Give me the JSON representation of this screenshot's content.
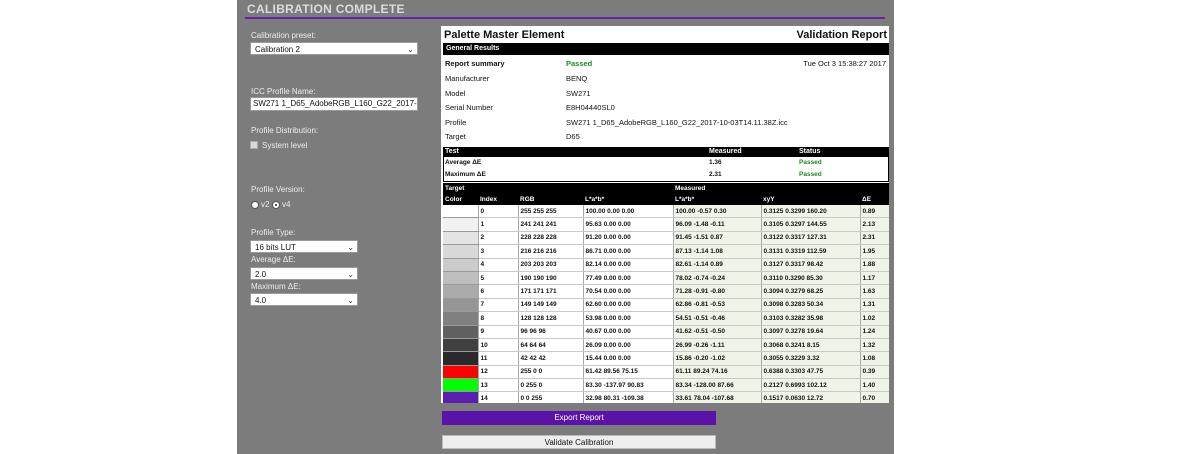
{
  "window": {
    "title": "CALIBRATION COMPLETE"
  },
  "colors": {
    "accent": "#6a1fa6",
    "passed": "#1c8a1c",
    "panel_bg": "#7c7c7c"
  },
  "sidebar": {
    "preset_label": "Calibration preset:",
    "preset_value": "Calibration 2",
    "icc_label": "ICC Profile Name:",
    "icc_value": "SW271 1_D65_AdobeRGB_L160_G22_2017-",
    "distribution_label": "Profile Distribution:",
    "system_level": "System level",
    "version_label": "Profile Version:",
    "version_v2": "v2",
    "version_v4": "v4",
    "version_selected": "v4",
    "type_label": "Profile Type:",
    "type_value": "16 bits LUT",
    "avg_label": "Average ΔE:",
    "avg_value": "2.0",
    "max_label": "Maximum ΔE:",
    "max_value": "4.0"
  },
  "report": {
    "app_name": "Palette Master Element",
    "report_title": "Validation Report",
    "general_results": "General Results",
    "summary_label": "Report summary",
    "summary_status": "Passed",
    "date": "Tue Oct 3 15:38:27 2017",
    "info": [
      {
        "label": "Manufacturer",
        "value": "BENQ"
      },
      {
        "label": "Model",
        "value": "SW271"
      },
      {
        "label": "Serial Number",
        "value": "E8H04440SL0"
      },
      {
        "label": "Profile",
        "value": "SW271 1_D65_AdobeRGB_L160_G22_2017-10-03T14.11.38Z.icc"
      },
      {
        "label": "Target",
        "value": "D65"
      }
    ],
    "test_headers": {
      "test": "Test",
      "measured": "Measured",
      "status": "Status"
    },
    "tests": [
      {
        "name": "Average ΔE",
        "measured": "1.36",
        "status": "Passed"
      },
      {
        "name": "Maximum ΔE",
        "measured": "2.31",
        "status": "Passed"
      }
    ],
    "group_headers": {
      "target": "Target",
      "measured": "Measured"
    },
    "col_headers": {
      "color": "Color",
      "index": "Index",
      "rgb": "RGB",
      "lab_target": "L*a*b*",
      "lab_measured": "L*a*b*",
      "xyy": "xyY",
      "de": "ΔE"
    },
    "rows": [
      {
        "swatch": "#ffffff",
        "index": "0",
        "rgb": "255  255  255",
        "lab_t": "100.00  0.00  0.00",
        "lab_m": "100.00  -0.57  0.30",
        "xyy": "0.3125  0.3299  160.20",
        "de": "0.89"
      },
      {
        "swatch": "#f1f1f1",
        "index": "1",
        "rgb": "241  241  241",
        "lab_t": "95.63  0.00  0.00",
        "lab_m": "96.09  -1.48  -0.11",
        "xyy": "0.3105  0.3297  144.55",
        "de": "2.13"
      },
      {
        "swatch": "#e4e4e4",
        "index": "2",
        "rgb": "228  228  228",
        "lab_t": "91.20  0.00  0.00",
        "lab_m": "91.45  -1.51  0.87",
        "xyy": "0.3122  0.3317  127.31",
        "de": "2.31"
      },
      {
        "swatch": "#d8d8d8",
        "index": "3",
        "rgb": "216  216  216",
        "lab_t": "86.71  0.00  0.00",
        "lab_m": "87.13  -1.14  1.08",
        "xyy": "0.3131  0.3319  112.59",
        "de": "1.95"
      },
      {
        "swatch": "#cbcbcb",
        "index": "4",
        "rgb": "203  203  203",
        "lab_t": "82.14  0.00  0.00",
        "lab_m": "82.61  -1.14  0.89",
        "xyy": "0.3127  0.3317  98.42",
        "de": "1.88"
      },
      {
        "swatch": "#bebebe",
        "index": "5",
        "rgb": "190  190  190",
        "lab_t": "77.49  0.00  0.00",
        "lab_m": "78.02  -0.74  -0.24",
        "xyy": "0.3110  0.3290  85.30",
        "de": "1.17"
      },
      {
        "swatch": "#ababab",
        "index": "6",
        "rgb": "171  171  171",
        "lab_t": "70.54  0.00  0.00",
        "lab_m": "71.28  -0.91  -0.80",
        "xyy": "0.3094  0.3279  68.25",
        "de": "1.63"
      },
      {
        "swatch": "#959595",
        "index": "7",
        "rgb": "149  149  149",
        "lab_t": "62.60  0.00  0.00",
        "lab_m": "62.86  -0.81  -0.53",
        "xyy": "0.3098  0.3283  50.34",
        "de": "1.31"
      },
      {
        "swatch": "#808080",
        "index": "8",
        "rgb": "128  128  128",
        "lab_t": "53.98  0.00  0.00",
        "lab_m": "54.51  -0.51  -0.46",
        "xyy": "0.3103  0.3282  35.98",
        "de": "1.02"
      },
      {
        "swatch": "#606060",
        "index": "9",
        "rgb": "96  96  96",
        "lab_t": "40.67  0.00  0.00",
        "lab_m": "41.62  -0.51  -0.50",
        "xyy": "0.3097  0.3278  19.64",
        "de": "1.24"
      },
      {
        "swatch": "#404040",
        "index": "10",
        "rgb": "64  64  64",
        "lab_t": "26.09  0.00  0.00",
        "lab_m": "26.99  -0.26  -1.11",
        "xyy": "0.3068  0.3241  8.15",
        "de": "1.32"
      },
      {
        "swatch": "#2a2a2a",
        "index": "11",
        "rgb": "42  42  42",
        "lab_t": "15.44  0.00  0.00",
        "lab_m": "15.86  -0.20  -1.02",
        "xyy": "0.3055  0.3229  3.32",
        "de": "1.08"
      },
      {
        "swatch": "#ff0000",
        "index": "12",
        "rgb": "255  0  0",
        "lab_t": "61.42  89.56  75.15",
        "lab_m": "61.11  89.24  74.16",
        "xyy": "0.6388  0.3303  47.75",
        "de": "0.39"
      },
      {
        "swatch": "#00ff00",
        "index": "13",
        "rgb": "0  255  0",
        "lab_t": "83.30  -137.97  90.83",
        "lab_m": "83.34  -128.00  87.66",
        "xyy": "0.2127  0.6993  102.12",
        "de": "1.40"
      },
      {
        "swatch": "#5a1fb0",
        "index": "14",
        "rgb": "0  0  255",
        "lab_t": "32.98  80.31  -109.38",
        "lab_m": "33.61  78.04  -107.68",
        "xyy": "0.1517  0.0630  12.72",
        "de": "0.70"
      }
    ]
  },
  "buttons": {
    "export": "Export Report",
    "validate": "Validate Calibration"
  }
}
